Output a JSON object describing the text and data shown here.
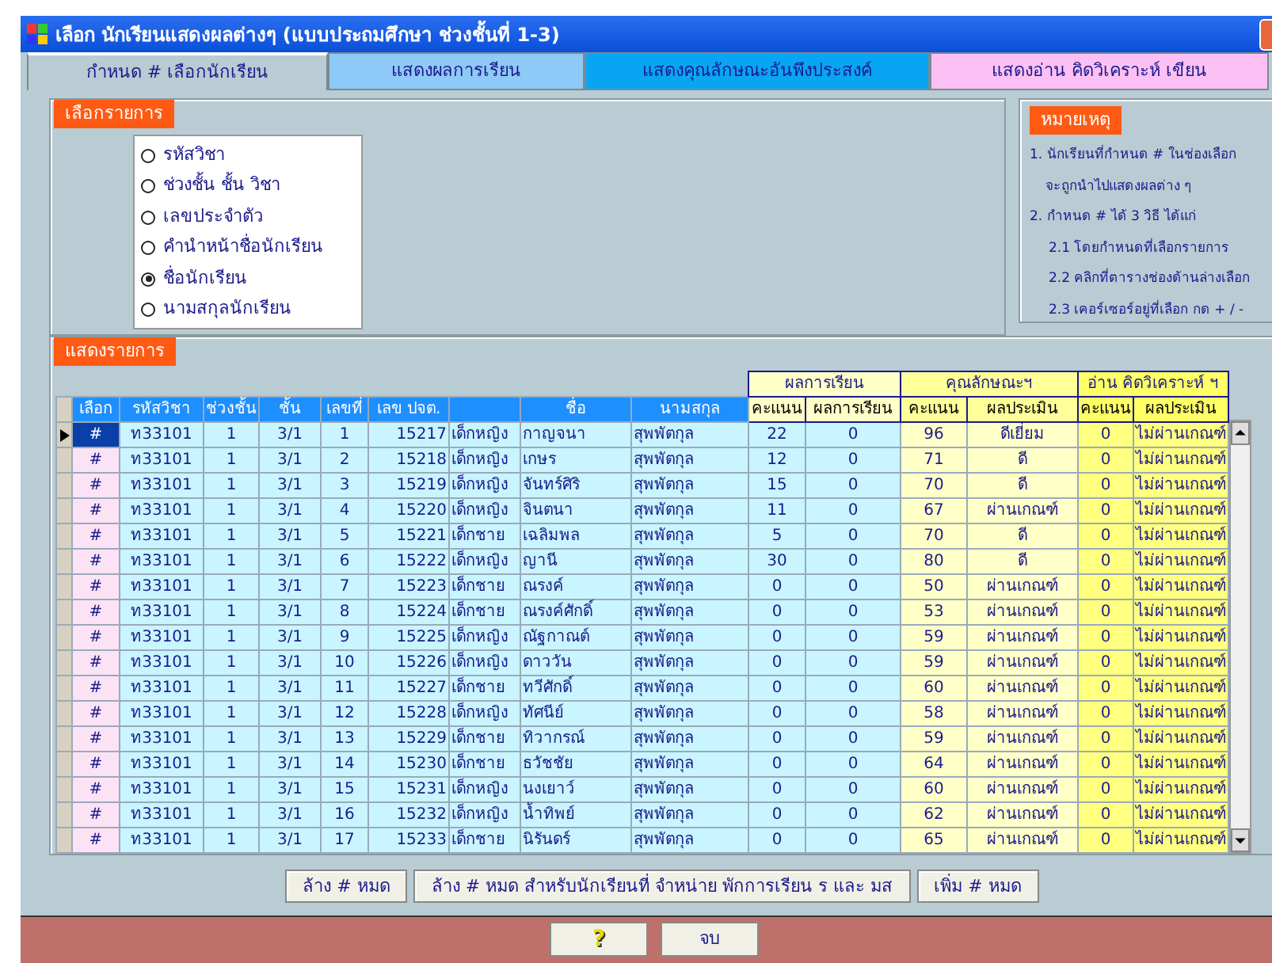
{
  "window": {
    "title": "เลือก นักเรียนแสดงผลต่างๆ (แบบประถมศึกษา ช่วงชั้นที่ 1-3)"
  },
  "tabs": [
    {
      "label": "กำหนด # เลือกนักเรียน",
      "selected": true,
      "color": "#b9cbd3"
    },
    {
      "label": "แสดงผลการเรียน",
      "selected": false,
      "color": "#8ec9f7"
    },
    {
      "label": "แสดงคุณลักษณะอันพึงประสงค์",
      "selected": false,
      "color": "#08a6f2"
    },
    {
      "label": "แสดงอ่าน คิดวิเคราะห์ เขียน",
      "selected": false,
      "color": "#fcc0f4"
    }
  ],
  "choose": {
    "label": "เลือกรายการ",
    "options": [
      {
        "label": "รหัสวิชา",
        "selected": false
      },
      {
        "label": "ช่วงชั้น ชั้น วิชา",
        "selected": false
      },
      {
        "label": "เลขประจำตัว",
        "selected": false
      },
      {
        "label": "คำนำหน้าชื่อนักเรียน",
        "selected": false
      },
      {
        "label": "ชื่อนักเรียน",
        "selected": true
      },
      {
        "label": "นามสกุลนักเรียน",
        "selected": false
      }
    ]
  },
  "notes": {
    "label": "หมายเหตุ",
    "items": [
      {
        "lines": [
          "1. นักเรียนที่กำหนด # ในช่องเลือก",
          "จะถูกนำไปแสดงผลต่าง ๆ"
        ]
      },
      {
        "lines": [
          "2. กำหนด # ได้  3 วิธี  ได้แก่"
        ],
        "children": [
          {
            "lines": [
              "2.1 โดยกำหนดที่เลือกรายการ"
            ]
          },
          {
            "lines": [
              "2.2 คลิกที่ตารางช่องด้านล่างเลือก"
            ]
          },
          {
            "lines": [
              "2.3 เคอร์เซอร์อยู่ที่เลือก กด + / -"
            ]
          }
        ]
      }
    ]
  },
  "table": {
    "label": "แสดงรายการ",
    "group_headers": [
      {
        "label": "ผลการเรียน",
        "color": "#ffffc8"
      },
      {
        "label": "คุณลักษณะฯ",
        "color": "#ffff99"
      },
      {
        "label": "อ่าน คิดวิเคราะห์ ฯ",
        "color": "#ffff66"
      }
    ],
    "columns": [
      {
        "label": "เลือก"
      },
      {
        "label": "รหัสวิชา"
      },
      {
        "label": "ช่วงชั้น"
      },
      {
        "label": "ชั้น"
      },
      {
        "label": "เลขที่"
      },
      {
        "label": "เลข ปจต."
      },
      {},
      {
        "label": "ชื่อ"
      },
      {
        "label": "นามสกุล"
      },
      {
        "label": "คะแนน"
      },
      {
        "label": "ผลการเรียน"
      },
      {
        "label": "คะแนน"
      },
      {
        "label": "ผลประเมิน"
      },
      {
        "label": "คะแนน"
      },
      {
        "label": "ผลประเมิน"
      }
    ],
    "rows": [
      {
        "selected": true,
        "cells": [
          "#",
          "ท33101",
          "1",
          "3/1",
          "1",
          "15217",
          "เด็กหญิง",
          "กาญจนา",
          "สุพพัตกุล",
          "22",
          "0",
          "96",
          "ดีเยี่ยม",
          "0",
          "ไม่ผ่านเกณฑ์"
        ]
      },
      {
        "selected": false,
        "cells": [
          "#",
          "ท33101",
          "1",
          "3/1",
          "2",
          "15218",
          "เด็กหญิง",
          "เกษร",
          "สุพพัตกุล",
          "12",
          "0",
          "71",
          "ดี",
          "0",
          "ไม่ผ่านเกณฑ์"
        ]
      },
      {
        "selected": false,
        "cells": [
          "#",
          "ท33101",
          "1",
          "3/1",
          "3",
          "15219",
          "เด็กหญิง",
          "จันทร์ศิริ",
          "สุพพัตกุล",
          "15",
          "0",
          "70",
          "ดี",
          "0",
          "ไม่ผ่านเกณฑ์"
        ]
      },
      {
        "selected": false,
        "cells": [
          "#",
          "ท33101",
          "1",
          "3/1",
          "4",
          "15220",
          "เด็กหญิง",
          "จินตนา",
          "สุพพัตกุล",
          "11",
          "0",
          "67",
          "ผ่านเกณฑ์",
          "0",
          "ไม่ผ่านเกณฑ์"
        ]
      },
      {
        "selected": false,
        "cells": [
          "#",
          "ท33101",
          "1",
          "3/1",
          "5",
          "15221",
          "เด็กชาย",
          "เฉลิมพล",
          "สุพพัตกุล",
          "5",
          "0",
          "70",
          "ดี",
          "0",
          "ไม่ผ่านเกณฑ์"
        ]
      },
      {
        "selected": false,
        "cells": [
          "#",
          "ท33101",
          "1",
          "3/1",
          "6",
          "15222",
          "เด็กหญิง",
          "ญานี",
          "สุพพัตกุล",
          "30",
          "0",
          "80",
          "ดี",
          "0",
          "ไม่ผ่านเกณฑ์"
        ]
      },
      {
        "selected": false,
        "cells": [
          "#",
          "ท33101",
          "1",
          "3/1",
          "7",
          "15223",
          "เด็กชาย",
          "ณรงค์",
          "สุพพัตกุล",
          "0",
          "0",
          "50",
          "ผ่านเกณฑ์",
          "0",
          "ไม่ผ่านเกณฑ์"
        ]
      },
      {
        "selected": false,
        "cells": [
          "#",
          "ท33101",
          "1",
          "3/1",
          "8",
          "15224",
          "เด็กชาย",
          "ณรงค์ศักดิ์",
          "สุพพัตกุล",
          "0",
          "0",
          "53",
          "ผ่านเกณฑ์",
          "0",
          "ไม่ผ่านเกณฑ์"
        ]
      },
      {
        "selected": false,
        "cells": [
          "#",
          "ท33101",
          "1",
          "3/1",
          "9",
          "15225",
          "เด็กหญิง",
          "ณัฐกาณต์",
          "สุพพัตกุล",
          "0",
          "0",
          "59",
          "ผ่านเกณฑ์",
          "0",
          "ไม่ผ่านเกณฑ์"
        ]
      },
      {
        "selected": false,
        "cells": [
          "#",
          "ท33101",
          "1",
          "3/1",
          "10",
          "15226",
          "เด็กหญิง",
          "ดาววัน",
          "สุพพัตกุล",
          "0",
          "0",
          "59",
          "ผ่านเกณฑ์",
          "0",
          "ไม่ผ่านเกณฑ์"
        ]
      },
      {
        "selected": false,
        "cells": [
          "#",
          "ท33101",
          "1",
          "3/1",
          "11",
          "15227",
          "เด็กชาย",
          "ทวีศักดิ์",
          "สุพพัตกุล",
          "0",
          "0",
          "60",
          "ผ่านเกณฑ์",
          "0",
          "ไม่ผ่านเกณฑ์"
        ]
      },
      {
        "selected": false,
        "cells": [
          "#",
          "ท33101",
          "1",
          "3/1",
          "12",
          "15228",
          "เด็กหญิง",
          "ทัศนีย์",
          "สุพพัตกุล",
          "0",
          "0",
          "58",
          "ผ่านเกณฑ์",
          "0",
          "ไม่ผ่านเกณฑ์"
        ]
      },
      {
        "selected": false,
        "cells": [
          "#",
          "ท33101",
          "1",
          "3/1",
          "13",
          "15229",
          "เด็กชาย",
          "ทิวากรณ์",
          "สุพพัตกุล",
          "0",
          "0",
          "59",
          "ผ่านเกณฑ์",
          "0",
          "ไม่ผ่านเกณฑ์"
        ]
      },
      {
        "selected": false,
        "cells": [
          "#",
          "ท33101",
          "1",
          "3/1",
          "14",
          "15230",
          "เด็กชาย",
          "ธวัชชัย",
          "สุพพัตกุล",
          "0",
          "0",
          "64",
          "ผ่านเกณฑ์",
          "0",
          "ไม่ผ่านเกณฑ์"
        ]
      },
      {
        "selected": false,
        "cells": [
          "#",
          "ท33101",
          "1",
          "3/1",
          "15",
          "15231",
          "เด็กหญิง",
          "นงเยาว์",
          "สุพพัตกุล",
          "0",
          "0",
          "60",
          "ผ่านเกณฑ์",
          "0",
          "ไม่ผ่านเกณฑ์"
        ]
      },
      {
        "selected": false,
        "cells": [
          "#",
          "ท33101",
          "1",
          "3/1",
          "16",
          "15232",
          "เด็กหญิง",
          "น้ำทิพย์",
          "สุพพัตกุล",
          "0",
          "0",
          "62",
          "ผ่านเกณฑ์",
          "0",
          "ไม่ผ่านเกณฑ์"
        ]
      },
      {
        "selected": false,
        "cells": [
          "#",
          "ท33101",
          "1",
          "3/1",
          "17",
          "15233",
          "เด็กชาย",
          "นิรันดร์",
          "สุพพัตกุล",
          "0",
          "0",
          "65",
          "ผ่านเกณฑ์",
          "0",
          "ไม่ผ่านเกณฑ์"
        ]
      }
    ]
  },
  "actions": [
    {
      "label": "ล้าง # หมด"
    },
    {
      "label": "ล้าง # หมด สำหรับนักเรียนที่ จำหน่าย พักการเรียน ร และ มส"
    },
    {
      "label": "เพิ่ม # หมด"
    }
  ],
  "footer": [
    {
      "label": "?",
      "kind": "help"
    },
    {
      "label": "จบ",
      "kind": "text"
    }
  ]
}
